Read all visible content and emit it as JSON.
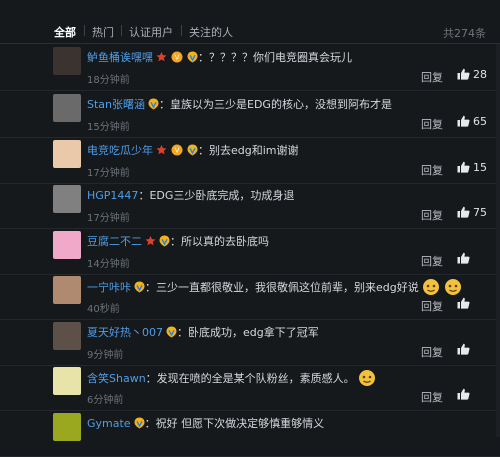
{
  "tabs": [
    {
      "label": "全部",
      "active": true
    },
    {
      "label": "热门",
      "active": false
    },
    {
      "label": "认证用户",
      "active": false
    },
    {
      "label": "关注的人",
      "active": false
    }
  ],
  "total_count": "共274条",
  "reply_label": "回复",
  "comments": [
    {
      "user": "鲈鱼桶诶嘿嘿",
      "name_color": "#4f9de8",
      "badges": [
        "star",
        "vip-icon",
        "v-badge-icon"
      ],
      "text": "？？？？你们电竞圈真会玩儿",
      "time": "18分钟前",
      "likes": "28",
      "avatar_color": "#3a3330"
    },
    {
      "user": "Stan张曙涵",
      "name_color": "#4f9de8",
      "badges": [
        "v-badge-icon"
      ],
      "text": "皇族以为三少是EDG的核心，没想到阿布才是",
      "time": "15分钟前",
      "likes": "65",
      "avatar_color": "#6a6a6a"
    },
    {
      "user": "电竞吃瓜少年",
      "name_color": "#4f9de8",
      "badges": [
        "star",
        "vip-icon",
        "v-badge-icon"
      ],
      "text": "别去edg和im谢谢",
      "time": "17分钟前",
      "likes": "15",
      "avatar_color": "#e9c9a9"
    },
    {
      "user": "HGP1447",
      "name_color": "#4f9de8",
      "badges": [],
      "text": "EDG三少卧底完成，功成身退",
      "time": "17分钟前",
      "likes": "75",
      "avatar_color": "#808080"
    },
    {
      "user": "豆腐二不二",
      "name_color": "#4f9de8",
      "badges": [
        "star",
        "v-badge-icon"
      ],
      "text": "所以真的去卧底吗",
      "time": "14分钟前",
      "likes": "",
      "avatar_color": "#f0a9c9"
    },
    {
      "user": "一宁咔咔",
      "name_color": "#4f9de8",
      "badges": [
        "v-badge-icon"
      ],
      "text": "三少一直都很敬业，我很敬佩这位前辈，别来edg好说",
      "time": "40秒前",
      "likes": "",
      "avatar_color": "#b08a70",
      "emojis": 2
    },
    {
      "user": "夏天好热丶007",
      "name_color": "#4f9de8",
      "badges": [
        "v-badge-icon"
      ],
      "text": "卧底成功，edg拿下了冠军",
      "time": "9分钟前",
      "likes": "",
      "avatar_color": "#5c5048"
    },
    {
      "user": "含笑Shawn",
      "name_color": "#4f9de8",
      "badges": [],
      "text": "发现在喷的全是某个队粉丝，素质感人。",
      "time": "6分钟前",
      "likes": "",
      "avatar_color": "#e8e3a8",
      "emojis": 1
    },
    {
      "user": "Gymate",
      "name_color": "#4f9de8",
      "badges": [
        "v-badge-icon"
      ],
      "text": "祝好 但愿下次做决定够慎重够情义",
      "time": "",
      "likes": "",
      "avatar_color": "#9aa820"
    }
  ]
}
